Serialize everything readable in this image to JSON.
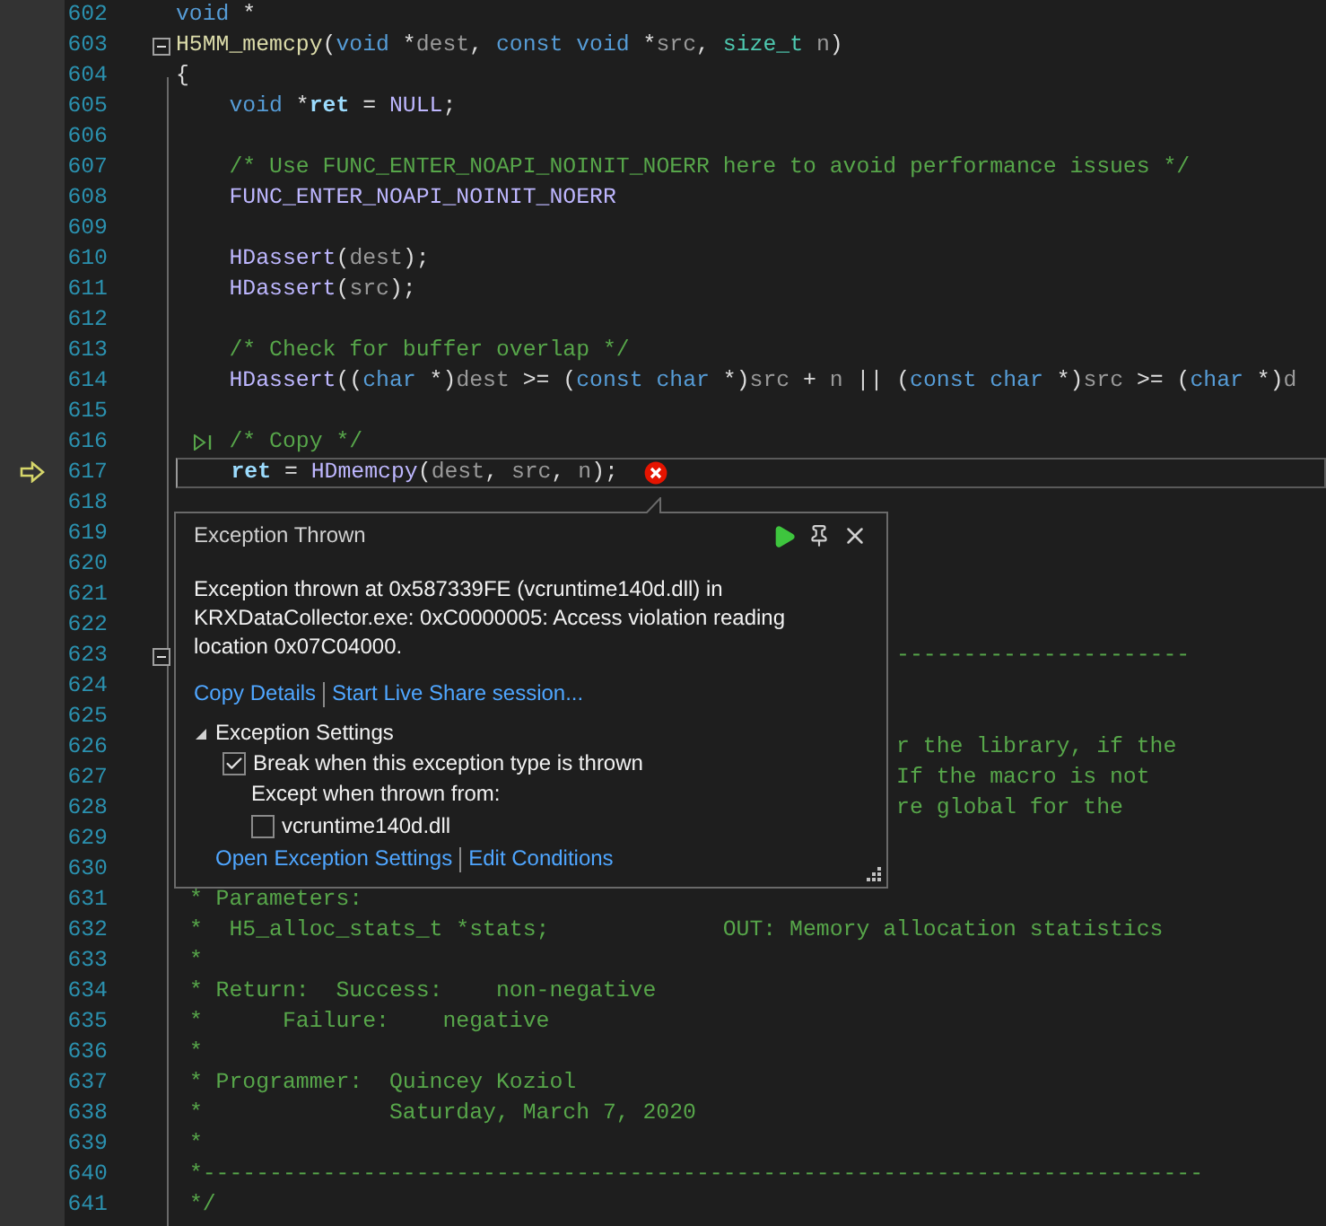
{
  "editor": {
    "lines": [
      {
        "number": "602",
        "current": false,
        "code": [
          {
            "kind": "keyword",
            "text": "void"
          },
          {
            "kind": "plain",
            "text": " *"
          }
        ]
      },
      {
        "number": "603",
        "current": false,
        "expanded": true,
        "code": [
          {
            "kind": "function",
            "text": "H5MM_memcpy"
          },
          {
            "kind": "plain",
            "text": "("
          },
          {
            "kind": "keyword",
            "text": "void"
          },
          {
            "kind": "plain",
            "text": " *"
          },
          {
            "kind": "param",
            "text": "dest"
          },
          {
            "kind": "plain",
            "text": ", "
          },
          {
            "kind": "keyword",
            "text": "const"
          },
          {
            "kind": "keyword",
            "text": " void"
          },
          {
            "kind": "plain",
            "text": " *"
          },
          {
            "kind": "param",
            "text": "src"
          },
          {
            "kind": "plain",
            "text": ", "
          },
          {
            "kind": "type",
            "text": "size_t"
          },
          {
            "kind": "param",
            "text": " n"
          },
          {
            "kind": "plain",
            "text": ")"
          }
        ]
      },
      {
        "number": "604",
        "current": false,
        "code": [
          {
            "kind": "plain",
            "text": "{"
          }
        ]
      },
      {
        "number": "605",
        "current": false,
        "code": [
          {
            "kind": "keyword",
            "text": "    void"
          },
          {
            "kind": "plain",
            "text": " *"
          },
          {
            "kind": "variable",
            "text": "ret"
          },
          {
            "kind": "plain",
            "text": " = "
          },
          {
            "kind": "macro",
            "text": "NULL"
          },
          {
            "kind": "plain",
            "text": ";"
          }
        ]
      },
      {
        "number": "606",
        "current": false
      },
      {
        "number": "607",
        "current": false,
        "code": [
          {
            "kind": "comment",
            "text": "    /* Use FUNC_ENTER_NOAPI_NOINIT_NOERR here to avoid performance issues */"
          }
        ]
      },
      {
        "number": "608",
        "current": false,
        "code": [
          {
            "kind": "macro",
            "text": "    FUNC_ENTER_NOAPI_NOINIT_NOERR"
          }
        ]
      },
      {
        "number": "609",
        "current": false
      },
      {
        "number": "610",
        "current": false,
        "code": [
          {
            "kind": "macro",
            "text": "    HDassert"
          },
          {
            "kind": "plain",
            "text": "("
          },
          {
            "kind": "param",
            "text": "dest"
          },
          {
            "kind": "plain",
            "text": ");"
          }
        ]
      },
      {
        "number": "611",
        "current": false,
        "code": [
          {
            "kind": "macro",
            "text": "    HDassert"
          },
          {
            "kind": "plain",
            "text": "("
          },
          {
            "kind": "param",
            "text": "src"
          },
          {
            "kind": "plain",
            "text": ");"
          }
        ]
      },
      {
        "number": "612",
        "current": false
      },
      {
        "number": "613",
        "current": false,
        "code": [
          {
            "kind": "comment",
            "text": "    /* Check for buffer overlap */"
          }
        ]
      },
      {
        "number": "614",
        "current": false,
        "code": [
          {
            "kind": "macro",
            "text": "    HDassert"
          },
          {
            "kind": "plain",
            "text": "(("
          },
          {
            "kind": "keyword",
            "text": "char"
          },
          {
            "kind": "plain",
            "text": " *)"
          },
          {
            "kind": "param",
            "text": "dest"
          },
          {
            "kind": "plain",
            "text": " >= ("
          },
          {
            "kind": "keyword",
            "text": "const char"
          },
          {
            "kind": "plain",
            "text": " *)"
          },
          {
            "kind": "param",
            "text": "src"
          },
          {
            "kind": "plain",
            "text": " + "
          },
          {
            "kind": "param",
            "text": "n"
          },
          {
            "kind": "plain",
            "text": " || ("
          },
          {
            "kind": "keyword",
            "text": "const char"
          },
          {
            "kind": "plain",
            "text": " *)"
          },
          {
            "kind": "param",
            "text": "src"
          },
          {
            "kind": "plain",
            "text": " >= ("
          },
          {
            "kind": "keyword",
            "text": "char"
          },
          {
            "kind": "plain",
            "text": " *)"
          },
          {
            "kind": "param",
            "text": "d"
          }
        ]
      },
      {
        "number": "615",
        "current": false
      },
      {
        "number": "616",
        "current": false,
        "run_to_click": true,
        "code": [
          {
            "kind": "comment",
            "text": "    /* Copy */"
          }
        ]
      },
      {
        "number": "617",
        "current": true,
        "error": true,
        "code": [
          {
            "kind": "variable",
            "text": "    ret"
          },
          {
            "kind": "plain",
            "text": " = "
          },
          {
            "kind": "macro",
            "text": "HDmemcpy"
          },
          {
            "kind": "plain",
            "text": "("
          },
          {
            "kind": "param",
            "text": "dest"
          },
          {
            "kind": "plain",
            "text": ", "
          },
          {
            "kind": "param",
            "text": "src"
          },
          {
            "kind": "plain",
            "text": ", "
          },
          {
            "kind": "param",
            "text": "n"
          },
          {
            "kind": "plain",
            "text": ");"
          }
        ]
      },
      {
        "number": "618",
        "current": false
      },
      {
        "number": "619",
        "current": false
      },
      {
        "number": "620",
        "current": false
      },
      {
        "number": "621",
        "current": false
      },
      {
        "number": "622",
        "current": false
      },
      {
        "number": "623",
        "current": false,
        "expanded": true,
        "code": [
          {
            "kind": "comment",
            "text": "                                                      ----------------------"
          }
        ]
      },
      {
        "number": "624",
        "current": false
      },
      {
        "number": "625",
        "current": false
      },
      {
        "number": "626",
        "current": false,
        "code": [
          {
            "kind": "comment",
            "text": "                                                      r the library, if the"
          }
        ]
      },
      {
        "number": "627",
        "current": false,
        "code": [
          {
            "kind": "comment",
            "text": "                                                      If the macro is not"
          }
        ]
      },
      {
        "number": "628",
        "current": false,
        "code": [
          {
            "kind": "comment",
            "text": "                                                      re global for the"
          }
        ]
      },
      {
        "number": "629",
        "current": false
      },
      {
        "number": "630",
        "current": false
      },
      {
        "number": "631",
        "current": false,
        "code": [
          {
            "kind": "comment",
            "text": " * Parameters:"
          }
        ]
      },
      {
        "number": "632",
        "current": false,
        "code": [
          {
            "kind": "comment",
            "text": " *  H5_alloc_stats_t *stats;             OUT: Memory allocation statistics"
          }
        ]
      },
      {
        "number": "633",
        "current": false,
        "code": [
          {
            "kind": "comment",
            "text": " *"
          }
        ]
      },
      {
        "number": "634",
        "current": false,
        "code": [
          {
            "kind": "comment",
            "text": " * Return:  Success:    non-negative"
          }
        ]
      },
      {
        "number": "635",
        "current": false,
        "code": [
          {
            "kind": "comment",
            "text": " *      Failure:    negative"
          }
        ]
      },
      {
        "number": "636",
        "current": false,
        "code": [
          {
            "kind": "comment",
            "text": " *"
          }
        ]
      },
      {
        "number": "637",
        "current": false,
        "code": [
          {
            "kind": "comment",
            "text": " * Programmer:  Quincey Koziol"
          }
        ]
      },
      {
        "number": "638",
        "current": false,
        "code": [
          {
            "kind": "comment",
            "text": " *              Saturday, March 7, 2020"
          }
        ]
      },
      {
        "number": "639",
        "current": false,
        "code": [
          {
            "kind": "comment",
            "text": " *"
          }
        ]
      },
      {
        "number": "640",
        "current": false,
        "code": [
          {
            "kind": "comment",
            "text": " *---------------------------------------------------------------------------"
          }
        ]
      },
      {
        "number": "641",
        "current": false,
        "code": [
          {
            "kind": "comment",
            "text": " */"
          }
        ]
      }
    ]
  },
  "exception_popup": {
    "title": "Exception Thrown",
    "message": "Exception thrown at 0x587339FE (vcruntime140d.dll) in KRXDataCollector.exe: 0xC0000005: Access violation reading location 0x07C04000.",
    "links": [
      "Copy Details",
      "Start Live Share session..."
    ],
    "settings": {
      "label": "Exception Settings",
      "expanded": true,
      "break_option": {
        "label": "Break when this exception type is thrown",
        "checked": true
      },
      "except_label": "Except when thrown from:",
      "modules": [
        {
          "label": "vcruntime140d.dll",
          "checked": false
        }
      ]
    },
    "footer_links": [
      "Open Exception Settings",
      "Edit Conditions"
    ]
  }
}
